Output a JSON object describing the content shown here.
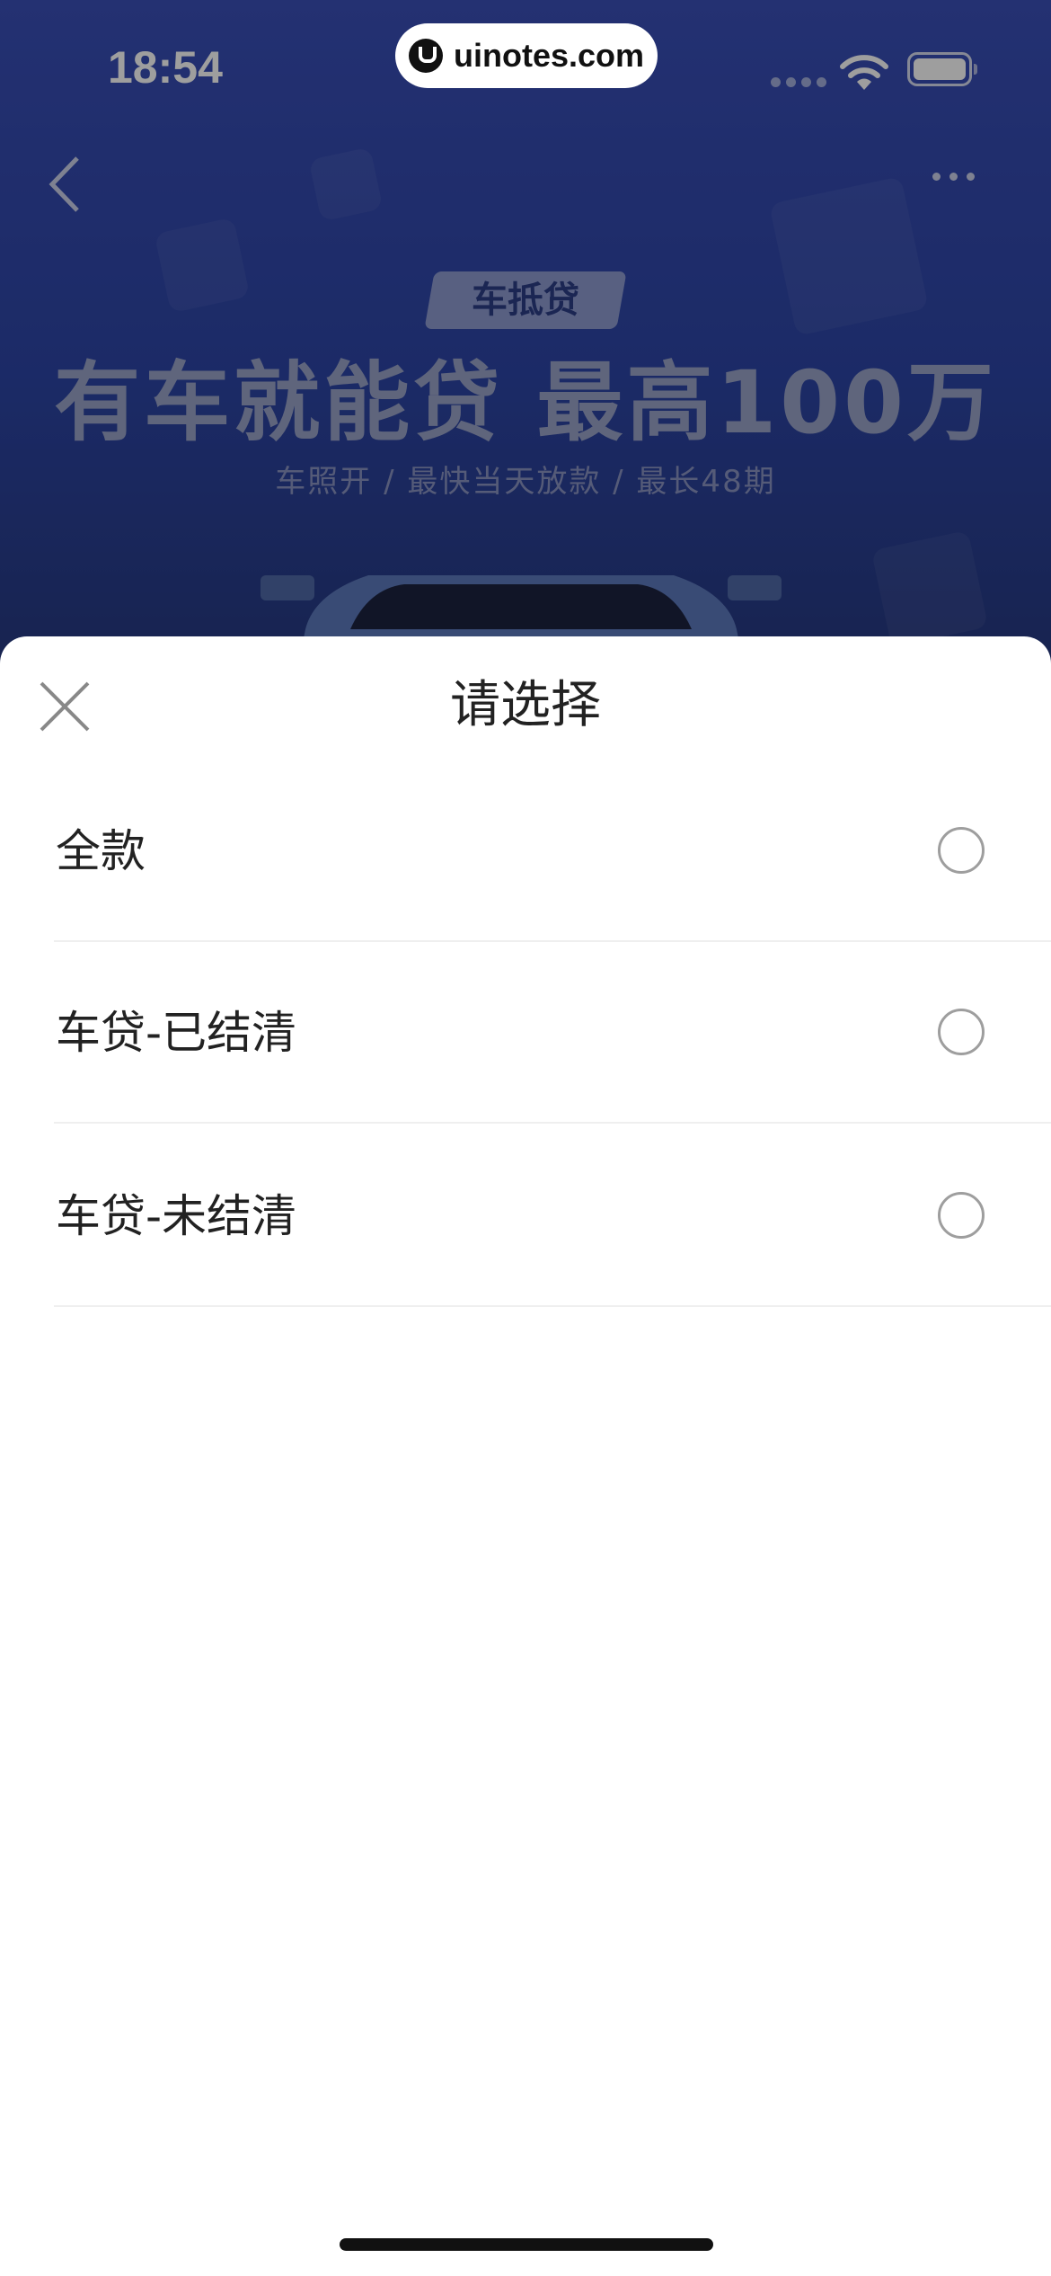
{
  "status_bar": {
    "time": "18:54"
  },
  "watermark": {
    "text": "uinotes.com"
  },
  "banner": {
    "badge": "车抵贷",
    "title": "有车就能贷 最高100万",
    "subtitle": "车照开 / 最快当天放款 / 最长48期"
  },
  "sheet": {
    "title": "请选择",
    "options": [
      {
        "label": "全款",
        "selected": false
      },
      {
        "label": "车贷-已结清",
        "selected": false
      },
      {
        "label": "车贷-未结清",
        "selected": false
      }
    ]
  }
}
